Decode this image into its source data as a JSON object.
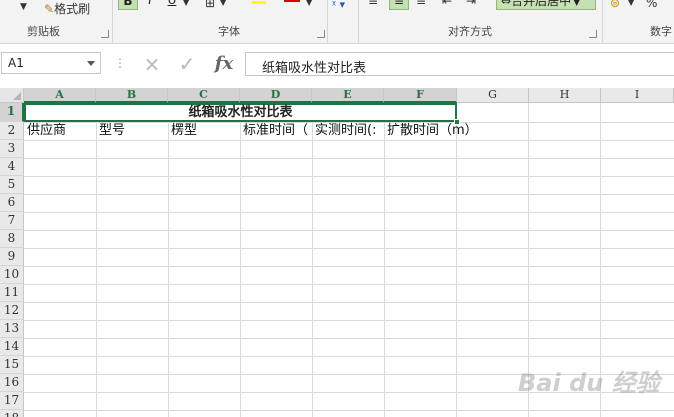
{
  "ribbon": {
    "format_painter_label": "格式刷",
    "bold_label": "B",
    "italic_label": "I",
    "underline_label": "U",
    "font_color_label": "A",
    "merge_center_label": "合并后居中",
    "clipboard_group": "剪贴板",
    "font_group": "字体",
    "alignment_group": "对齐方式",
    "number_group": "数字",
    "percent_label": "%"
  },
  "formula_bar": {
    "name_box_value": "A1",
    "cancel_icon": "×",
    "enter_icon": "✓",
    "fx_label": "fx",
    "formula_value": "纸箱吸水性对比表"
  },
  "sheet": {
    "columns": [
      "A",
      "B",
      "C",
      "D",
      "E",
      "F",
      "G",
      "H",
      "I"
    ],
    "rows": [
      "1",
      "2",
      "3",
      "4",
      "5",
      "6",
      "7",
      "8",
      "9",
      "10",
      "11",
      "12",
      "13",
      "14",
      "15",
      "16",
      "17",
      "18"
    ],
    "title": "纸箱吸水性对比表",
    "headers": [
      "供应商",
      "型号",
      "楞型",
      "标准时间（",
      "实测时间(:",
      "扩散时间（m）"
    ]
  },
  "watermark": {
    "text": "Bai du 经验"
  },
  "colors": {
    "accent": "#217346",
    "selected_fill": "#c6e0b4"
  }
}
